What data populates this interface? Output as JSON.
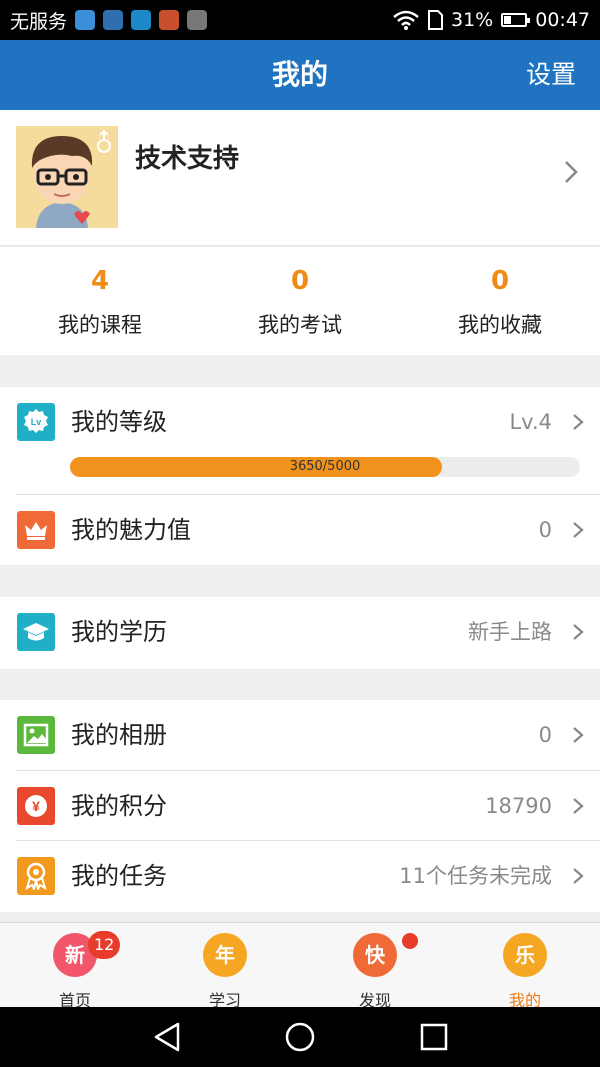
{
  "status_bar": {
    "carrier": "无服务",
    "battery": "31%",
    "time": "00:47"
  },
  "app_bar": {
    "title": "我的",
    "settings_label": "设置"
  },
  "profile": {
    "username": "技术支持"
  },
  "stats": [
    {
      "value": "4",
      "label": "我的课程"
    },
    {
      "value": "0",
      "label": "我的考试"
    },
    {
      "value": "0",
      "label": "我的收藏"
    }
  ],
  "level": {
    "label": "我的等级",
    "value": "Lv.4",
    "icon_text": "Lv",
    "progress_text": "3650/5000",
    "progress_fraction": 0.73,
    "icon_color": "#1fb0c8"
  },
  "rows": {
    "charm": {
      "label": "我的魅力值",
      "value": "0",
      "icon_color": "#ef6a36"
    },
    "education": {
      "label": "我的学历",
      "value": "新手上路",
      "icon_color": "#1fb0c8"
    },
    "album": {
      "label": "我的相册",
      "value": "0",
      "icon_color": "#5cb83a"
    },
    "points": {
      "label": "我的积分",
      "value": "18790",
      "icon_text": "¥",
      "icon_color": "#e8482c"
    },
    "tasks": {
      "label": "我的任务",
      "value": "11个任务未完成",
      "icon_color": "#f29a1e"
    }
  },
  "tabs": [
    {
      "label": "首页",
      "icon_text": "新",
      "badge": "12",
      "icon": "new-year-new-icon"
    },
    {
      "label": "学习",
      "icon_text": "年",
      "icon": "new-year-nian-icon"
    },
    {
      "label": "发现",
      "icon_text": "快",
      "icon": "new-year-kuai-icon",
      "dot": true
    },
    {
      "label": "我的",
      "icon_text": "乐",
      "icon": "new-year-le-icon",
      "active": true
    }
  ],
  "colors": {
    "primary": "#1f73c1",
    "accent": "#ef8c15",
    "badge": "#e83b2b"
  }
}
